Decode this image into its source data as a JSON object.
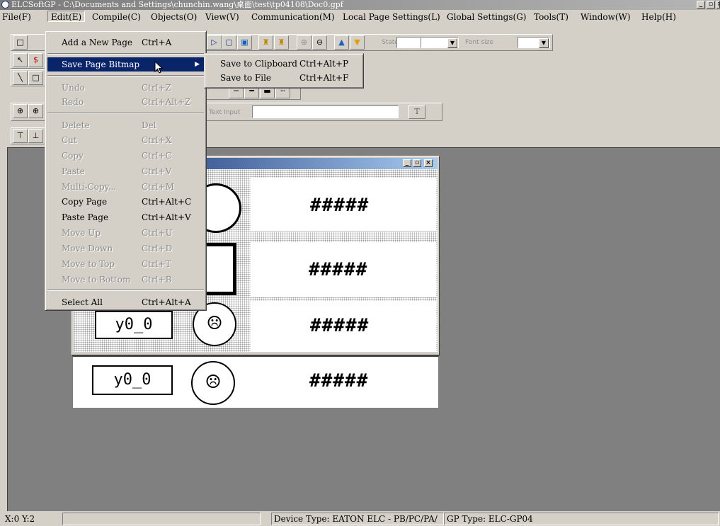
{
  "app": {
    "title": "ELCSoftGP - C:\\Documents and Settings\\chunchin.wang\\桌面\\test\\tp04108\\Doc0.gpf",
    "min": "_",
    "max": "▫",
    "close": "×"
  },
  "menubar": [
    "File(F)",
    "Edit(E)",
    "Compile(C)",
    "Objects(O)",
    "View(V)",
    "Communication(M)",
    "Local Page Settings(L)",
    "Global Settings(G)",
    "Tools(T)",
    "Window(W)",
    "Help(H)"
  ],
  "toolbar": {
    "state_label": "State",
    "font_size_label": "Font size",
    "text_input_label": "Text Input",
    "text_input_value": "",
    "t_button": "T"
  },
  "edit_menu": [
    {
      "label": "Add a New Page",
      "shortcut": "Ctrl+A",
      "enabled": true
    },
    {
      "label": "Save Page Bitmap",
      "shortcut": "",
      "enabled": true,
      "submenu": true
    },
    {
      "label": "Undo",
      "shortcut": "Ctrl+Z",
      "enabled": false
    },
    {
      "label": "Redo",
      "shortcut": "Ctrl+Alt+Z",
      "enabled": false
    },
    {
      "label": "Delete",
      "shortcut": "Del",
      "enabled": false
    },
    {
      "label": "Cut",
      "shortcut": "Ctrl+X",
      "enabled": false
    },
    {
      "label": "Copy",
      "shortcut": "Ctrl+C",
      "enabled": false
    },
    {
      "label": "Paste",
      "shortcut": "Ctrl+V",
      "enabled": false
    },
    {
      "label": "Multi-Copy...",
      "shortcut": "Ctrl+M",
      "enabled": false
    },
    {
      "label": "Copy Page",
      "shortcut": "Ctrl+Alt+C",
      "enabled": true
    },
    {
      "label": "Paste Page",
      "shortcut": "Ctrl+Alt+V",
      "enabled": true
    },
    {
      "label": "Move Up",
      "shortcut": "Ctrl+U",
      "enabled": false
    },
    {
      "label": "Move Down",
      "shortcut": "Ctrl+D",
      "enabled": false
    },
    {
      "label": "Move to Top",
      "shortcut": "Ctrl+T",
      "enabled": false
    },
    {
      "label": "Move to Bottom",
      "shortcut": "Ctrl+B",
      "enabled": false
    },
    {
      "label": "Select All",
      "shortcut": "Ctrl+Alt+A",
      "enabled": true
    }
  ],
  "submenu": [
    {
      "label": "Save to Clipboard",
      "shortcut": "Ctrl+Alt+P"
    },
    {
      "label": "Save to File",
      "shortcut": "Ctrl+Alt+F"
    }
  ],
  "page": {
    "hash_text": "#####",
    "label_text": "y0_0"
  },
  "status": {
    "coords": "X:0 Y:2",
    "device": "Device Type: EATON ELC - PB/PC/PA/",
    "gp": "GP Type: ELC-GP04"
  }
}
